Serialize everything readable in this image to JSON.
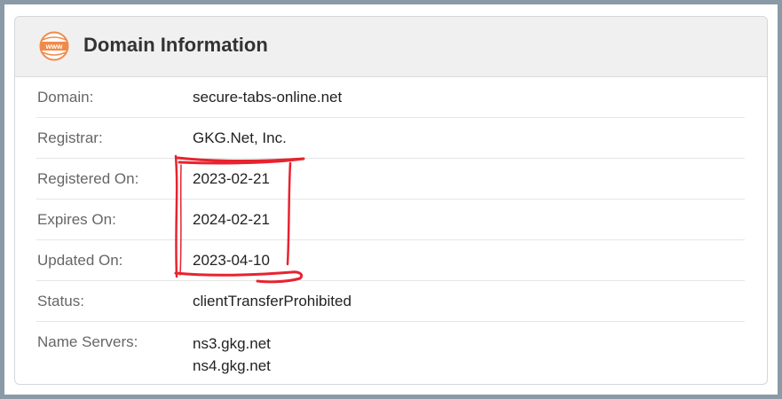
{
  "header": {
    "icon": "www-globe-icon",
    "icon_text": "www",
    "title": "Domain Information"
  },
  "rows": [
    {
      "label": "Domain:",
      "value": "secure-tabs-online.net"
    },
    {
      "label": "Registrar:",
      "value": "GKG.Net, Inc."
    },
    {
      "label": "Registered On:",
      "value": "2023-02-21"
    },
    {
      "label": "Expires On:",
      "value": "2024-02-21"
    },
    {
      "label": "Updated On:",
      "value": "2023-04-10"
    },
    {
      "label": "Status:",
      "value": "clientTransferProhibited"
    },
    {
      "label": "Name Servers:",
      "values": [
        "ns3.gkg.net",
        "ns4.gkg.net"
      ]
    }
  ],
  "colors": {
    "icon_accent": "#f08a4b",
    "highlight_marker": "#e8232e",
    "frame": "#8a9aa6",
    "header_bg": "#f0f0f0"
  }
}
